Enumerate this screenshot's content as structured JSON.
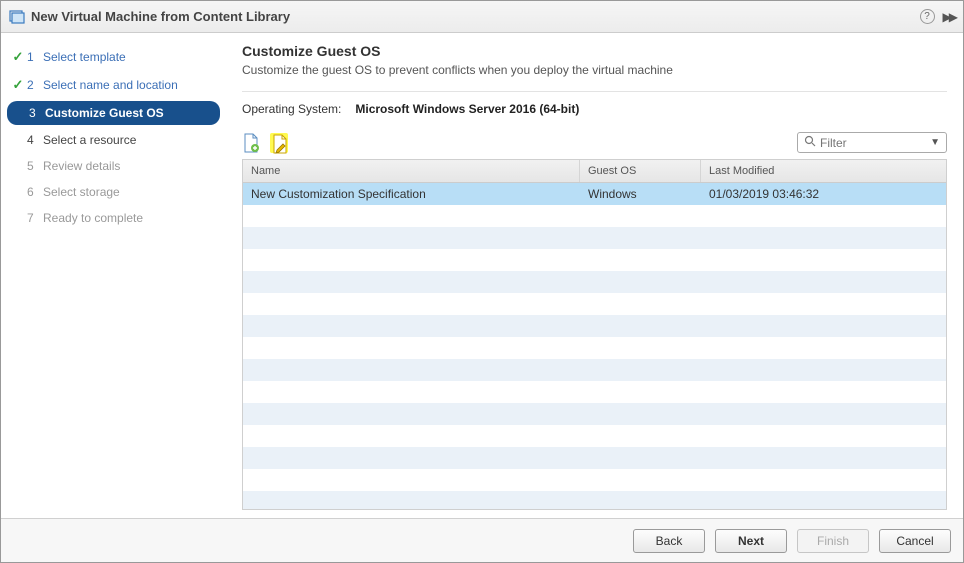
{
  "window": {
    "title": "New Virtual Machine from Content Library"
  },
  "steps": [
    {
      "num": "1",
      "label": "Select template",
      "state": "completed"
    },
    {
      "num": "2",
      "label": "Select name and location",
      "state": "completed"
    },
    {
      "num": "3",
      "label": "Customize Guest OS",
      "state": "current"
    },
    {
      "num": "4",
      "label": "Select a resource",
      "state": "pending"
    },
    {
      "num": "5",
      "label": "Review details",
      "state": "disabled"
    },
    {
      "num": "6",
      "label": "Select storage",
      "state": "disabled"
    },
    {
      "num": "7",
      "label": "Ready to complete",
      "state": "disabled"
    }
  ],
  "page": {
    "heading": "Customize Guest OS",
    "subtitle": "Customize the guest OS to prevent conflicts when you deploy the virtual machine",
    "os_label": "Operating System:",
    "os_value": "Microsoft Windows Server 2016 (64-bit)"
  },
  "filter": {
    "placeholder": "Filter"
  },
  "grid": {
    "headers": {
      "name": "Name",
      "guest_os": "Guest OS",
      "last_modified": "Last Modified"
    },
    "rows": [
      {
        "name": "New Customization Specification",
        "guest_os": "Windows",
        "last_modified": "01/03/2019 03:46:32",
        "selected": true
      }
    ],
    "blank_rows": 14
  },
  "buttons": {
    "back": "Back",
    "next": "Next",
    "finish": "Finish",
    "cancel": "Cancel"
  }
}
